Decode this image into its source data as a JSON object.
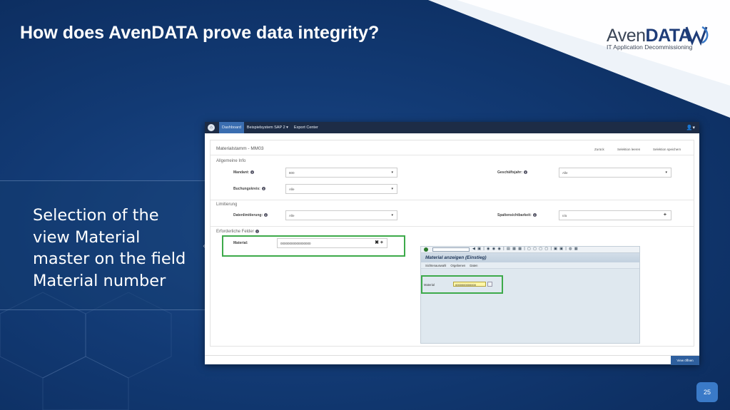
{
  "slide": {
    "title": "How does AvenDATA prove data integrity?",
    "caption": "Selection of the view Material master on the field Material number",
    "page_number": "25"
  },
  "logo": {
    "name_light": "Aven",
    "name_bold": "DATA",
    "tagline": "IT Application Decommissioning"
  },
  "app": {
    "nav": {
      "items": [
        "Dashboard",
        "Beispielsystem SAP 2 ▾",
        "Export Center"
      ],
      "active": "Dashboard"
    },
    "page_title": "Materialstamm - MM03",
    "toolbar": {
      "back": "Zurück",
      "clear": "Selektion leeren",
      "save": "Selektion speichern"
    },
    "sections": {
      "general": "Allgemeine Info",
      "limit": "Limitierung",
      "required": "Erforderliche Felder"
    },
    "fields": {
      "mandant_label": "Mandant:",
      "mandant_value": "800",
      "geschaeftsjahr_label": "Geschäftsjahr:",
      "geschaeftsjahr_value": "Alle",
      "buchungskreis_label": "Buchungskreis:",
      "buchungskreis_value": "Alle",
      "datenlimitierung_label": "Datenlimitierung:",
      "datenlimitierung_value": "Alle",
      "spaltensicht_label": "Spaltensichtbarkeit:",
      "spaltensicht_value": "n/a",
      "material_label": "Material:",
      "material_value": "00000000000000000"
    },
    "view_button": "View öffnen"
  },
  "sap": {
    "title": "Material anzeigen (Einstieg)",
    "menu": [
      "Sichtenauswahl",
      "Orgebenen",
      "Daten"
    ],
    "material_label": "Material",
    "material_value": "0000000000000"
  },
  "colors": {
    "highlight": "#3daa4a",
    "nav_bg": "#1d2c46",
    "accent": "#2e5f9e"
  }
}
